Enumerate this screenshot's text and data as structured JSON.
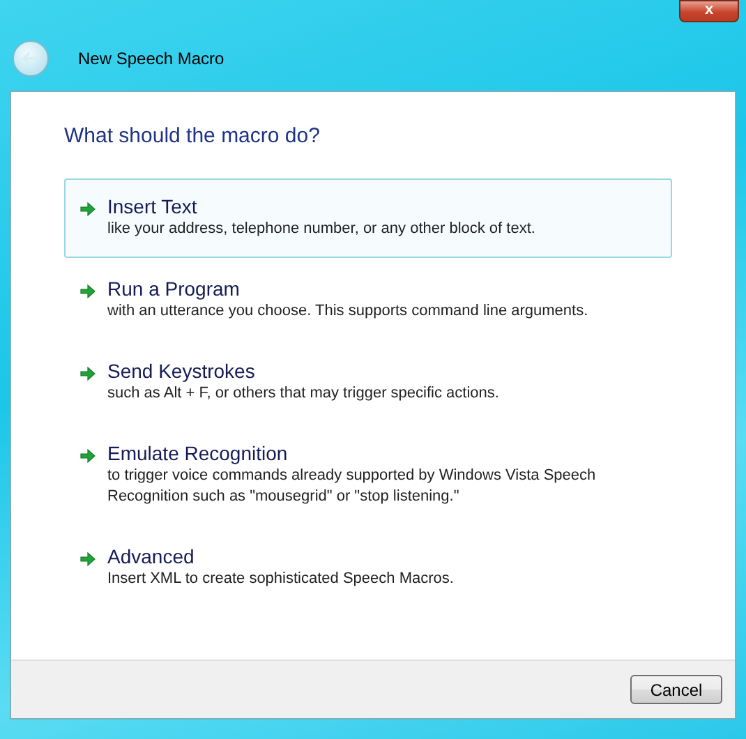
{
  "window": {
    "title": "New Speech Macro",
    "close_label": "x"
  },
  "heading": "What should the macro do?",
  "options": [
    {
      "title": "Insert Text",
      "description": "like your address, telephone number, or any other block of text.",
      "selected": true
    },
    {
      "title": "Run a Program",
      "description": "with an utterance you choose. This supports command line arguments.",
      "selected": false
    },
    {
      "title": "Send Keystrokes",
      "description": "such as Alt + F, or others that may trigger specific actions.",
      "selected": false
    },
    {
      "title": "Emulate Recognition",
      "description": "to trigger voice commands already supported by Windows Vista Speech Recognition such as \"mousegrid\" or \"stop listening.\"",
      "selected": false
    },
    {
      "title": "Advanced",
      "description": "Insert XML to create sophisticated Speech Macros.",
      "selected": false
    }
  ],
  "buttons": [
    "Cancel"
  ]
}
